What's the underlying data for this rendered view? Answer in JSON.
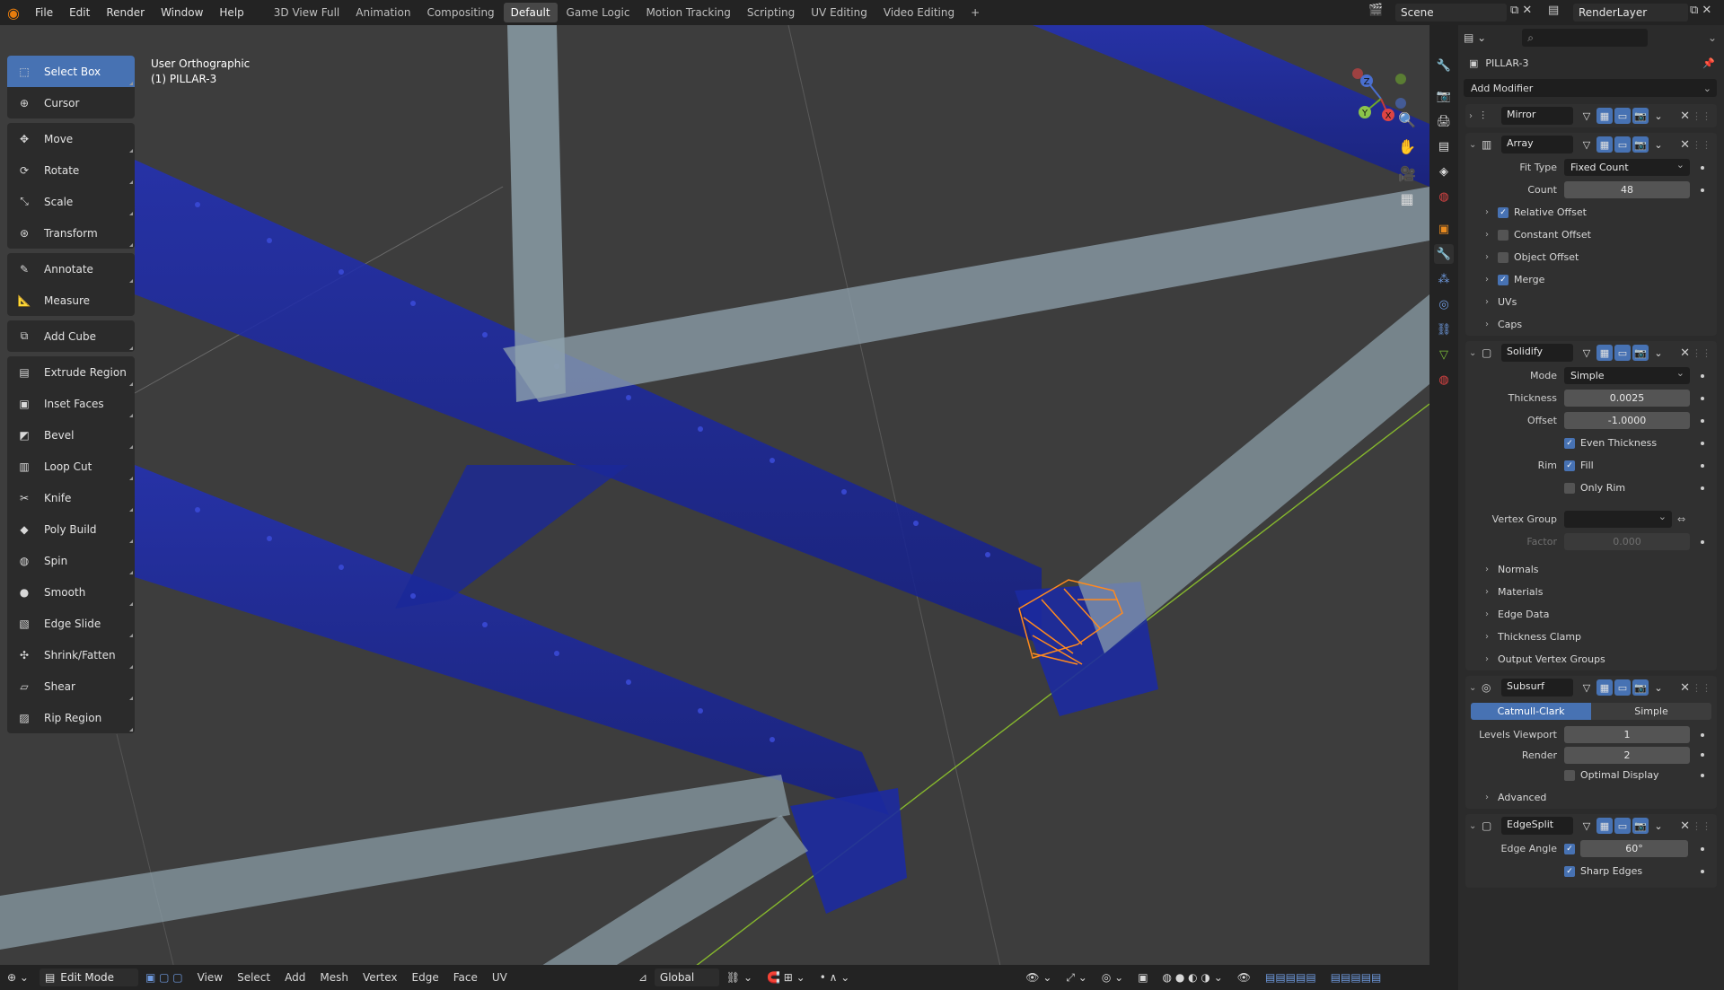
{
  "topbar": {
    "menus": [
      "File",
      "Edit",
      "Render",
      "Window",
      "Help"
    ],
    "workspaces": [
      "3D View Full",
      "Animation",
      "Compositing",
      "Default",
      "Game Logic",
      "Motion Tracking",
      "Scripting",
      "UV Editing",
      "Video Editing"
    ],
    "active_workspace": "Default",
    "add_tab": "+",
    "scene": "Scene",
    "render_layer": "RenderLayer"
  },
  "toolbar": {
    "groups": [
      [
        {
          "label": "Select Box",
          "icon": "select-box-icon",
          "glyph": "⬚",
          "active": true
        },
        {
          "label": "Cursor",
          "icon": "cursor-icon",
          "glyph": "⊕"
        }
      ],
      [
        {
          "label": "Move",
          "icon": "move-icon",
          "glyph": "✥"
        },
        {
          "label": "Rotate",
          "icon": "rotate-icon",
          "glyph": "⟳"
        },
        {
          "label": "Scale",
          "icon": "scale-icon",
          "glyph": "⤡"
        },
        {
          "label": "Transform",
          "icon": "transform-icon",
          "glyph": "⊛"
        }
      ],
      [
        {
          "label": "Annotate",
          "icon": "annotate-icon",
          "glyph": "✎"
        },
        {
          "label": "Measure",
          "icon": "measure-icon",
          "glyph": "📐"
        }
      ],
      [
        {
          "label": "Add Cube",
          "icon": "add-cube-icon",
          "glyph": "⧉"
        }
      ],
      [
        {
          "label": "Extrude Region",
          "icon": "extrude-icon",
          "glyph": "▤"
        },
        {
          "label": "Inset Faces",
          "icon": "inset-icon",
          "glyph": "▣"
        },
        {
          "label": "Bevel",
          "icon": "bevel-icon",
          "glyph": "◩"
        },
        {
          "label": "Loop Cut",
          "icon": "loop-cut-icon",
          "glyph": "▥"
        },
        {
          "label": "Knife",
          "icon": "knife-icon",
          "glyph": "✂"
        },
        {
          "label": "Poly Build",
          "icon": "poly-build-icon",
          "glyph": "◆"
        },
        {
          "label": "Spin",
          "icon": "spin-icon",
          "glyph": "◍"
        },
        {
          "label": "Smooth",
          "icon": "smooth-icon",
          "glyph": "●"
        },
        {
          "label": "Edge Slide",
          "icon": "edge-slide-icon",
          "glyph": "▧"
        },
        {
          "label": "Shrink/Fatten",
          "icon": "shrink-fatten-icon",
          "glyph": "✣"
        },
        {
          "label": "Shear",
          "icon": "shear-icon",
          "glyph": "▱"
        },
        {
          "label": "Rip Region",
          "icon": "rip-region-icon",
          "glyph": "▨"
        }
      ]
    ]
  },
  "viewport": {
    "view_name": "User Orthographic",
    "object_name": "(1) PILLAR-3",
    "gizmo": {
      "z": "Z",
      "y": "Y",
      "x": "X"
    }
  },
  "viewport_header": {
    "mode": "Edit Mode",
    "menus": [
      "View",
      "Select",
      "Add",
      "Mesh",
      "Vertex",
      "Edge",
      "Face",
      "UV"
    ],
    "orientation": "Global"
  },
  "properties": {
    "object": "PILLAR-3",
    "add_modifier": "Add Modifier",
    "mirror": {
      "name": "Mirror"
    },
    "array": {
      "name": "Array",
      "fit_type_label": "Fit Type",
      "fit_type": "Fixed Count",
      "count_label": "Count",
      "count": "48",
      "subs": [
        {
          "label": "Relative Offset",
          "checked": true
        },
        {
          "label": "Constant Offset",
          "checked": false
        },
        {
          "label": "Object Offset",
          "checked": false
        },
        {
          "label": "Merge",
          "checked": true
        }
      ],
      "plain_subs": [
        "UVs",
        "Caps"
      ]
    },
    "solidify": {
      "name": "Solidify",
      "mode_label": "Mode",
      "mode": "Simple",
      "thickness_label": "Thickness",
      "thickness": "0.0025",
      "offset_label": "Offset",
      "offset": "-1.0000",
      "even_thickness": "Even Thickness",
      "rim_label": "Rim",
      "fill": "Fill",
      "only_rim": "Only Rim",
      "vgroup_label": "Vertex Group",
      "factor_label": "Factor",
      "factor": "0.000",
      "subs": [
        "Normals",
        "Materials",
        "Edge Data",
        "Thickness Clamp",
        "Output Vertex Groups"
      ]
    },
    "subsurf": {
      "name": "Subsurf",
      "catmull": "Catmull-Clark",
      "simple": "Simple",
      "levels_label": "Levels Viewport",
      "levels": "1",
      "render_label": "Render",
      "render": "2",
      "optimal": "Optimal Display",
      "advanced": "Advanced"
    },
    "edgesplit": {
      "name": "EdgeSplit",
      "angle_label": "Edge Angle",
      "angle": "60°",
      "sharp": "Sharp Edges"
    }
  },
  "colors": {
    "accent": "#4772b3",
    "selection": "#ff8a1f",
    "beam_blue": "#1c2a9a",
    "beam_grey": "#8fa2ad",
    "background": "#3d3d3d"
  }
}
